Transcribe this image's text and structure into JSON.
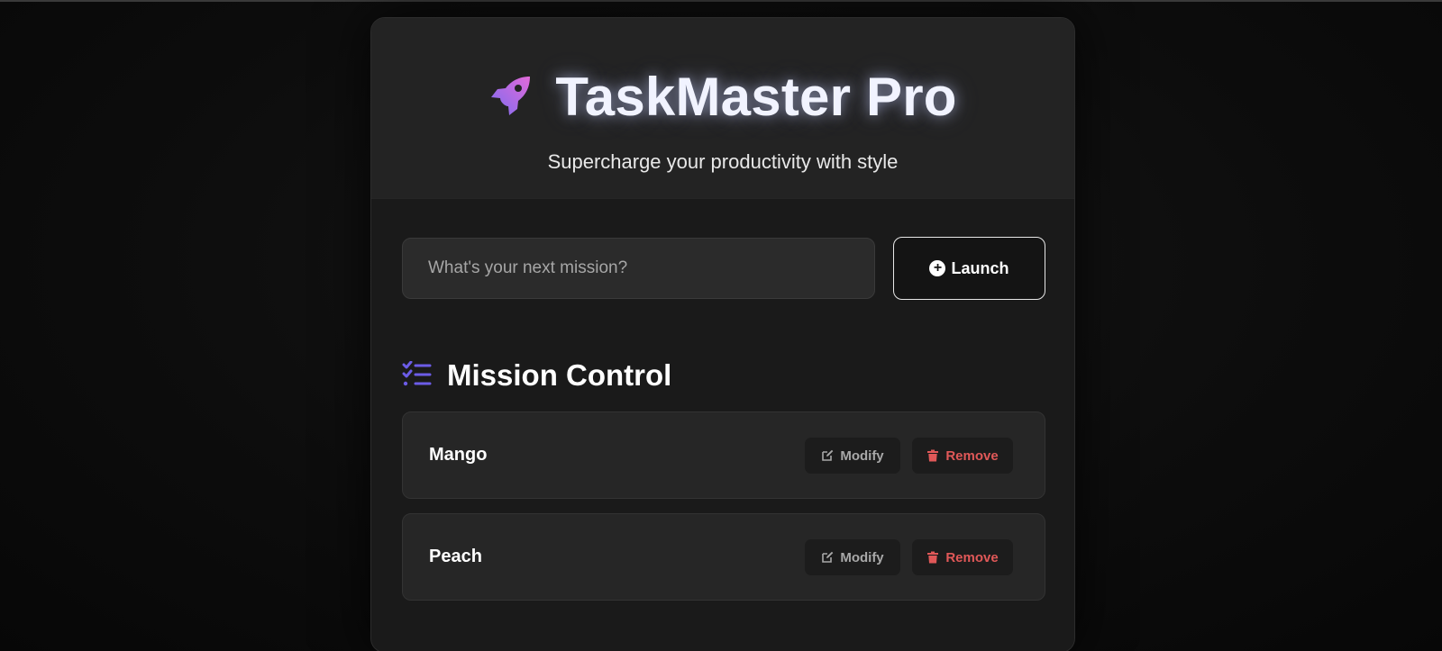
{
  "header": {
    "title": "TaskMaster Pro",
    "subtitle": "Supercharge your productivity with style",
    "icon": "rocket-icon"
  },
  "input": {
    "placeholder": "What's your next mission?",
    "value": ""
  },
  "launch_button": {
    "label": "Launch",
    "icon": "plus-circle-icon"
  },
  "section": {
    "title": "Mission Control",
    "icon": "task-list-icon"
  },
  "tasks": [
    {
      "name": "Mango",
      "modify_label": "Modify",
      "remove_label": "Remove"
    },
    {
      "name": "Peach",
      "modify_label": "Modify",
      "remove_label": "Remove"
    }
  ],
  "colors": {
    "accent_purple": "#7c6cf0",
    "accent_pink": "#e26ad8",
    "remove_red": "#e05858",
    "background": "#0b0b0b",
    "card": "#1a1a1a"
  }
}
